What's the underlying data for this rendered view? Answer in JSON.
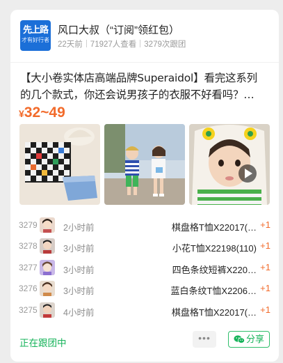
{
  "shop": {
    "avatar_line1": "先上路",
    "avatar_line2": "才有好行者",
    "name": "风口大叔（“订阅”领红包）",
    "posted": "22天前",
    "views": "71927人查看",
    "followers": "3279次跟团"
  },
  "post": {
    "description": "【大小卷实体店高端品牌Superaidol】看完这系列的几个款式，你还会说男孩子的衣服不好看吗？…",
    "price_symbol": "¥",
    "price_range": "32~49"
  },
  "photos": [
    {
      "name": "checkered-tshirt-photo"
    },
    {
      "name": "kids-walking-photo"
    },
    {
      "name": "child-video-photo",
      "has_video": true
    }
  ],
  "orders": [
    {
      "number": "3279",
      "time": "2小时前",
      "item": "棋盘格T恤X22017(…",
      "count": "+1"
    },
    {
      "number": "3278",
      "time": "3小时前",
      "item": "小花T恤X22198(110)",
      "count": "+1"
    },
    {
      "number": "3277",
      "time": "3小时前",
      "item": "四色条纹短裤X220…",
      "count": "+1"
    },
    {
      "number": "3276",
      "time": "3小时前",
      "item": "蓝白条纹T恤X2206…",
      "count": "+1"
    },
    {
      "number": "3275",
      "time": "4小时前",
      "item": "棋盘格T恤X22017(…",
      "count": "+1"
    }
  ],
  "footer": {
    "status": "正在跟团中",
    "more_label": "•••",
    "share_label": "分享"
  },
  "colors": {
    "accent_orange": "#f26b2b",
    "accent_green": "#16b35a",
    "avatar_blue": "#1b6fd8"
  }
}
